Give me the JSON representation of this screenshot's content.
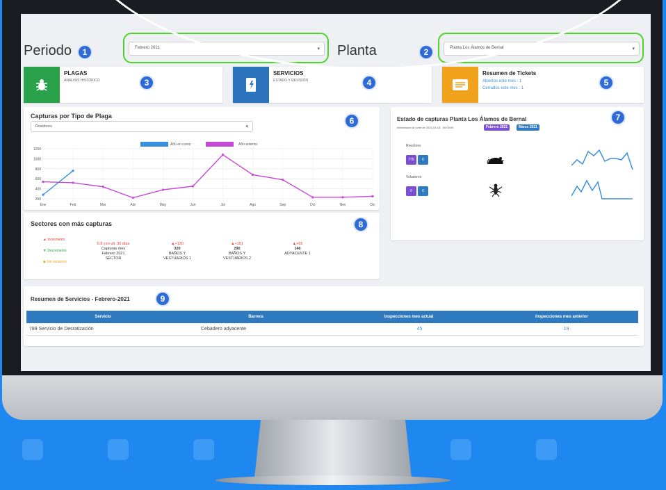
{
  "header": {
    "periodo_label": "Periodo",
    "periodo_value": "Febrero 2021",
    "planta_label": "Planta",
    "planta_value": "Planta Los Álamos de Bernal"
  },
  "markers": [
    "1",
    "2",
    "3",
    "4",
    "5",
    "6",
    "7",
    "8",
    "9"
  ],
  "tiles": {
    "plagas": {
      "title": "PLAGAS",
      "subtitle": "ANÁLISIS HISTÓRICO"
    },
    "servicios": {
      "title": "SERVICIOS",
      "subtitle": "ESTADO Y REVISIÓN"
    },
    "tickets": {
      "title": "Resumen de Tickets",
      "line1": "Abiertos este mes : 1",
      "line2": "Cerrados este mes : 1"
    }
  },
  "chart_card": {
    "title": "Capturas por Tipo de Plaga",
    "select_value": "Roedores"
  },
  "chart_data": {
    "type": "line",
    "title": "Capturas por Tipo de Plaga",
    "categories": [
      "Ene",
      "Feb",
      "Mar",
      "Abr",
      "May",
      "Jun",
      "Jul",
      "Ago",
      "Sep",
      "Oct",
      "Nov",
      "Dic"
    ],
    "yticks": [
      200,
      400,
      600,
      800,
      1000,
      1200
    ],
    "ylim": [
      200,
      1200
    ],
    "series": [
      {
        "name": "Año en curso",
        "color": "#3a8fdd",
        "values": [
          280,
          760,
          null,
          null,
          null,
          null,
          null,
          null,
          null,
          null,
          null,
          null
        ]
      },
      {
        "name": "Año anterior",
        "color": "#c548d6",
        "values": [
          540,
          520,
          440,
          220,
          380,
          450,
          1080,
          680,
          580,
          230,
          230,
          250
        ]
      }
    ],
    "legend_position": "top"
  },
  "sectores": {
    "title": "Sectores con más capturas",
    "legend": [
      "Incremento",
      "Decremento",
      "Sin variación"
    ],
    "head": {
      "line1": "0.8 con ult. 30 días",
      "line2": "Capturas mes",
      "line3": "Febrero 2021",
      "line4": "SECTOR"
    },
    "items": [
      {
        "change": "▲+130",
        "value": "320",
        "name1": "BAÑOS Y",
        "name2": "VESTUARIOS 1"
      },
      {
        "change": "▲+101",
        "value": "290",
        "name1": "BAÑOS Y",
        "name2": "VESTUARIOS 2"
      },
      {
        "change": "▲+66",
        "value": "146",
        "name1": "ADYACENTE 1",
        "name2": ""
      }
    ]
  },
  "estado": {
    "title": "Estado de capturas Planta Los Álamos de Bernal",
    "info": "Información al corte de 2021-03-16 - 00:00:00",
    "badge1": "Febrero 2021",
    "badge2": "Marzo 2021",
    "roedores_label": "Roedores",
    "roedores_b1": "776",
    "roedores_b2": "0",
    "voladores_label": "Voladores",
    "voladores_b1": "0",
    "voladores_b2": "0"
  },
  "servicios_resumen": {
    "title": "Resumen de Servicios - Febrero-2021",
    "headers": [
      "Servicio",
      "Barrera",
      "Inspecciones mes actual",
      "Inspecciones mes anterior"
    ],
    "rows": [
      [
        "789 Servicio de Desratización",
        "Cebadero adyacente",
        "45",
        "19"
      ]
    ]
  },
  "colors": {
    "accent": "#2f6bd6",
    "green": "#2aa14b",
    "blue": "#2b74bd",
    "orange": "#f1a21c",
    "purple": "#7b4fd1"
  }
}
